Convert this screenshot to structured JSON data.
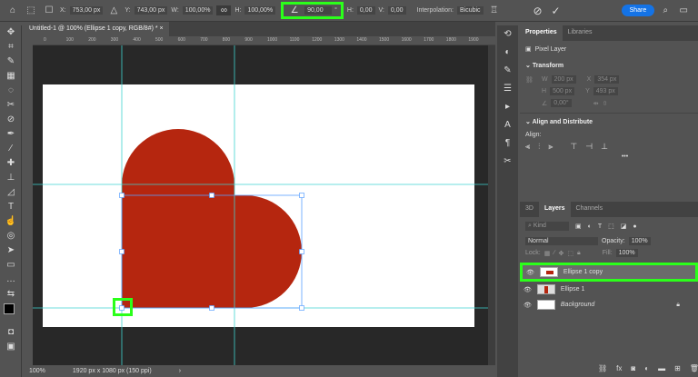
{
  "options_bar": {
    "x_label": "X:",
    "x_value": "753,00 px",
    "y_label": "Y:",
    "y_value": "743,00 px",
    "w_label": "W:",
    "w_value": "100,00%",
    "h_label": "H:",
    "h_value": "100,00%",
    "angle_value": "90,00",
    "angle_unit": "°",
    "hskew_label": "H:",
    "hskew_value": "0,00",
    "vskew_label": "V:",
    "vskew_value": "0,00",
    "interpolation_label": "Interpolation:",
    "interpolation_value": "Bicubic",
    "share_label": "Share"
  },
  "document_tab": {
    "title": "Untitled-1 @ 100% (Ellipse 1 copy, RGB/8#) *",
    "close": "×"
  },
  "ruler_ticks": [
    "0",
    "100",
    "200",
    "300",
    "400",
    "500",
    "600",
    "700",
    "800",
    "900",
    "1000",
    "1100",
    "1200",
    "1300",
    "1400",
    "1500",
    "1600",
    "1700",
    "1800",
    "1900"
  ],
  "status": {
    "zoom": "100%",
    "doc_info": "1920 px x 1080 px (150 ppi)",
    "arrow": "›"
  },
  "colors": {
    "shape": "#b5260f",
    "guide": "#3fd3d0",
    "highlight": "#2bff1a",
    "share": "#1473e6"
  },
  "properties": {
    "tabs": [
      "Properties",
      "Libraries"
    ],
    "layer_type": "Pixel Layer",
    "transform_title": "Transform",
    "w_label": "W",
    "w_value": "200 px",
    "x_label": "X",
    "x_value": "354 px",
    "h_label": "H",
    "h_value": "500 px",
    "y_label": "Y",
    "y_value": "493 px",
    "angle_value": "0,00°",
    "align_title": "Align and Distribute",
    "align_label": "Align:",
    "more": "•••"
  },
  "layers_panel": {
    "tabs": [
      "3D",
      "Layers",
      "Channels"
    ],
    "kind_placeholder": "Kind",
    "blend_mode": "Normal",
    "opacity_label": "Opacity:",
    "opacity_value": "100%",
    "lock_label": "Lock:",
    "fill_label": "Fill:",
    "fill_value": "100%",
    "layers": [
      {
        "name": "Ellipse 1 copy",
        "selected": true
      },
      {
        "name": "Ellipse 1",
        "selected": false
      },
      {
        "name": "Background",
        "selected": false,
        "locked": true
      }
    ]
  }
}
